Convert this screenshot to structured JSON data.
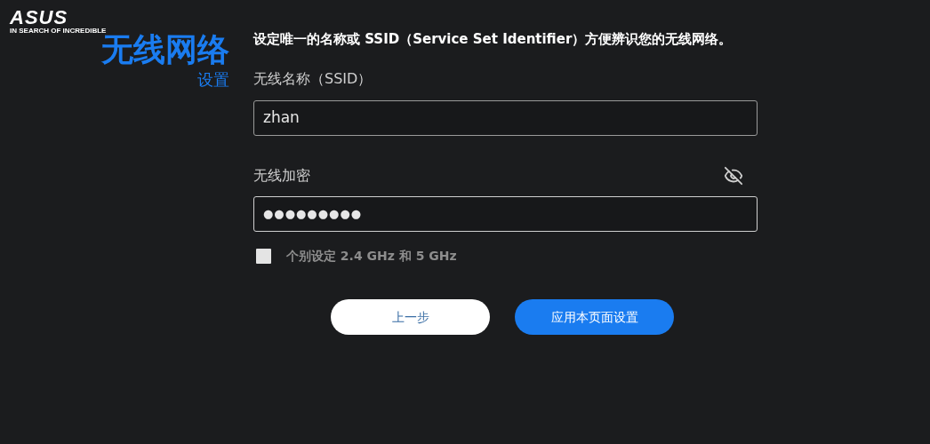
{
  "logo": {
    "brand": "ASUS",
    "tagline": "IN SEARCH OF INCREDIBLE"
  },
  "heading": {
    "title": "无线网络",
    "subtitle": "设置"
  },
  "description": "设定唯一的名称或 SSID（Service Set Identifier）方便辨识您的无线网络。",
  "ssid_field": {
    "label": "无线名称（SSID）",
    "value": "zhan"
  },
  "password_field": {
    "label": "无线加密",
    "value": "●●●●●●●●●",
    "password_visible": false
  },
  "separate_bands": {
    "label": "个别设定 2.4 GHz 和 5 GHz",
    "checked": false
  },
  "buttons": [
    {
      "label": "上一步",
      "kind": "secondary"
    },
    {
      "label": "应用本页面设置",
      "kind": "primary"
    }
  ]
}
